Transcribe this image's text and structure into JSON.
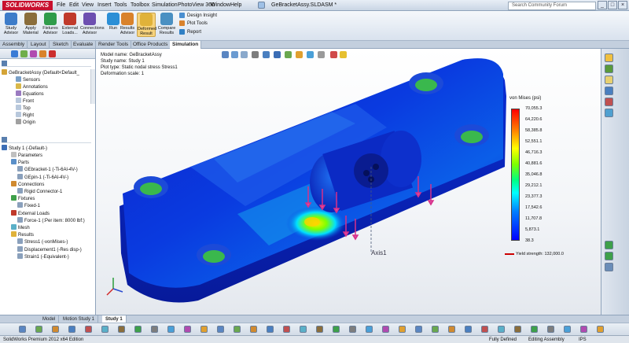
{
  "app": {
    "logo_text": "SOLIDWORKS",
    "menu": [
      "File",
      "Edit",
      "View",
      "Insert",
      "Tools",
      "Toolbox",
      "Simulation",
      "PhotoView 360",
      "Window",
      "Help"
    ],
    "document_title": "GeBracketAssy.SLDASM *",
    "search_placeholder": "Search Community Forum",
    "window_controls": [
      "_",
      "□",
      "×"
    ]
  },
  "ribbon": {
    "buttons": [
      {
        "label": "Study Advisor",
        "color": "#3d7cc9"
      },
      {
        "label": "Apply Material",
        "color": "#8a6d3b"
      },
      {
        "label": "Fixtures Advisor",
        "color": "#2f9c4a"
      },
      {
        "label": "External Loads...",
        "color": "#c03a2b"
      },
      {
        "label": "Connections Advisor",
        "color": "#6d4fb0"
      },
      {
        "label": "Run",
        "color": "#2c8fd6"
      },
      {
        "label": "Results Advisor",
        "color": "#d9822b"
      },
      {
        "label": "Deformed Result",
        "color": "#e0b23a"
      },
      {
        "label": "Compare Results",
        "color": "#4a90c2"
      }
    ],
    "small_items": [
      "Design Insight",
      "Plot Tools",
      "Report"
    ]
  },
  "command_tabs": [
    "Assembly",
    "Layout",
    "Sketch",
    "Evaluate",
    "Render Tools",
    "Office Products",
    "Simulation"
  ],
  "active_command_tab": "Simulation",
  "feature_tree": {
    "root": "GeBracketAssy  (Default<Default_",
    "items": [
      "Sensors",
      "Annotations",
      "Equations",
      "Front",
      "Top",
      "Right",
      "Origin"
    ]
  },
  "study_tree": {
    "study": "Study 1 (-Default-)",
    "items": [
      {
        "label": "Parameters",
        "indent": 1
      },
      {
        "label": "Parts",
        "indent": 1
      },
      {
        "label": "GEbracket-1 (-Ti-6Al-4V-)",
        "indent": 2
      },
      {
        "label": "GEpin-1 (-Ti-6Al-4V-)",
        "indent": 2
      },
      {
        "label": "Connections",
        "indent": 1
      },
      {
        "label": "Rigid Connector-1",
        "indent": 2
      },
      {
        "label": "Fixtures",
        "indent": 1
      },
      {
        "label": "Fixed-1",
        "indent": 2
      },
      {
        "label": "External Loads",
        "indent": 1
      },
      {
        "label": "Force-1 (:Per item: 8000 lbf:)",
        "indent": 2
      },
      {
        "label": "Mesh",
        "indent": 1
      },
      {
        "label": "Results",
        "indent": 1
      },
      {
        "label": "Stress1 (-vonMises-)",
        "indent": 2
      },
      {
        "label": "Displacement1 (-Res disp-)",
        "indent": 2
      },
      {
        "label": "Strain1 (-Equivalent-)",
        "indent": 2
      }
    ]
  },
  "plot_info": {
    "model_name": "Model name: GeBracketAssy",
    "study_name": "Study name: Study 1",
    "plot_type": "Plot type: Static nodal stress Stress1",
    "deformation": "Deformation scale: 1"
  },
  "legend": {
    "title": "von Mises (psi)",
    "ticks": [
      "70,055.3",
      "64,220.6",
      "58,385.8",
      "52,551.1",
      "46,716.3",
      "40,881.6",
      "35,046.8",
      "29,212.1",
      "23,377.3",
      "17,542.6",
      "11,707.8",
      "5,873.1",
      "38.3"
    ],
    "yield": "Yield strength: 132,000.0"
  },
  "axis_label": "Axis1",
  "bottom_tabs": [
    "Model",
    "Motion Study 1",
    "Study 1"
  ],
  "active_bottom_tab": "Study 1",
  "status": {
    "edition": "SolidWorks Premium 2012 x64 Edition",
    "definition": "Fully Defined",
    "mode": "Editing Assembly",
    "units": "IPS"
  }
}
